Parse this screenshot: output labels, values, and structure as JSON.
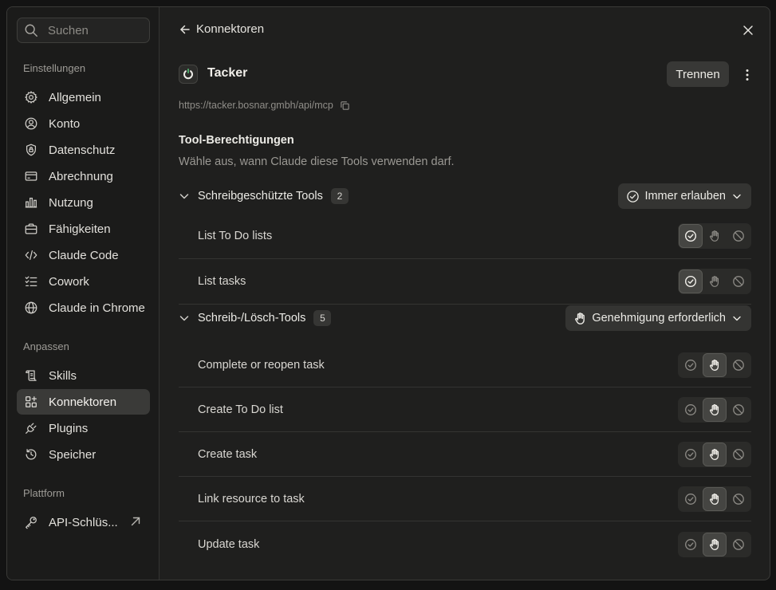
{
  "sidebar": {
    "search_placeholder": "Suchen",
    "sections": {
      "settings": "Einstellungen",
      "customize": "Anpassen",
      "platform": "Plattform"
    },
    "items": [
      {
        "label": "Allgemein",
        "icon": "gear-icon"
      },
      {
        "label": "Konto",
        "icon": "user-circle-icon"
      },
      {
        "label": "Datenschutz",
        "icon": "shield-lock-icon"
      },
      {
        "label": "Abrechnung",
        "icon": "credit-card-icon"
      },
      {
        "label": "Nutzung",
        "icon": "bar-chart-icon"
      },
      {
        "label": "Fähigkeiten",
        "icon": "briefcase-icon"
      },
      {
        "label": "Claude Code",
        "icon": "code-icon"
      },
      {
        "label": "Cowork",
        "icon": "checklist-icon"
      },
      {
        "label": "Claude in Chrome",
        "icon": "globe-icon"
      },
      {
        "label": "Skills",
        "icon": "scroll-icon"
      },
      {
        "label": "Konnektoren",
        "icon": "grid-plus-icon",
        "active": true
      },
      {
        "label": "Plugins",
        "icon": "plug-icon"
      },
      {
        "label": "Speicher",
        "icon": "history-icon"
      },
      {
        "label": "API-Schlüs...",
        "icon": "key-icon",
        "external": true
      }
    ]
  },
  "main": {
    "back_label": "Konnektoren",
    "connector": {
      "name": "Tacker",
      "url": "https://tacker.bosnar.gmbh/api/mcp",
      "disconnect_label": "Trennen"
    },
    "permissions": {
      "title": "Tool-Berechtigungen",
      "description": "Wähle aus, wann Claude diese Tools verwenden darf.",
      "groups": [
        {
          "name": "Schreibgeschützte Tools",
          "count": "2",
          "policy": "Immer erlauben",
          "policy_icon": "check-circle-icon",
          "tools": [
            {
              "name": "List To Do lists",
              "state": "allow"
            },
            {
              "name": "List tasks",
              "state": "allow"
            }
          ]
        },
        {
          "name": "Schreib-/Lösch-Tools",
          "count": "5",
          "policy": "Genehmigung erforderlich",
          "policy_icon": "hand-icon",
          "tools": [
            {
              "name": "Complete or reopen task",
              "state": "ask"
            },
            {
              "name": "Create To Do list",
              "state": "ask"
            },
            {
              "name": "Create task",
              "state": "ask"
            },
            {
              "name": "Link resource to task",
              "state": "ask"
            },
            {
              "name": "Update task",
              "state": "ask"
            }
          ]
        }
      ]
    }
  },
  "colors": {
    "background": "#1f1f1e",
    "sidebar": "#1b1b1a",
    "active_item": "#3a3a38",
    "text": "#e8e6e1",
    "muted_text": "#9a9893"
  }
}
